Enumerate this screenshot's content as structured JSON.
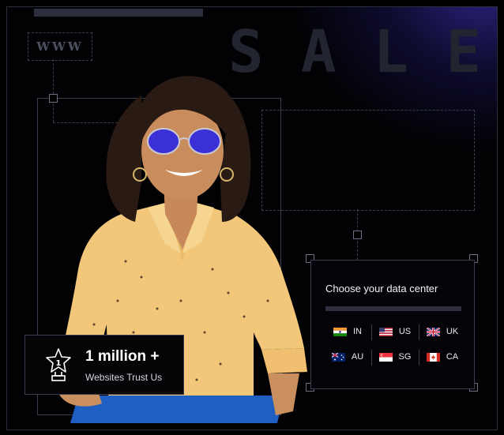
{
  "header": {
    "www_label": "WWW",
    "sale_letters": [
      "S",
      "A",
      "L",
      "E"
    ]
  },
  "data_center": {
    "title": "Choose your data center",
    "rows": [
      [
        {
          "code": "IN",
          "flag": "india-flag-icon"
        },
        {
          "code": "US",
          "flag": "usa-flag-icon"
        },
        {
          "code": "UK",
          "flag": "uk-flag-icon"
        }
      ],
      [
        {
          "code": "AU",
          "flag": "australia-flag-icon"
        },
        {
          "code": "SG",
          "flag": "singapore-flag-icon"
        },
        {
          "code": "CA",
          "flag": "canada-flag-icon"
        }
      ]
    ]
  },
  "trust_badge": {
    "headline": "1 million +",
    "subtext": "Websites Trust Us",
    "trophy_number": "1"
  },
  "colors": {
    "background": "#000000",
    "glow": "#3428a0",
    "lens": "#3b2fd6",
    "shirt": "#f2c77a",
    "pants": "#1f5fc2"
  }
}
